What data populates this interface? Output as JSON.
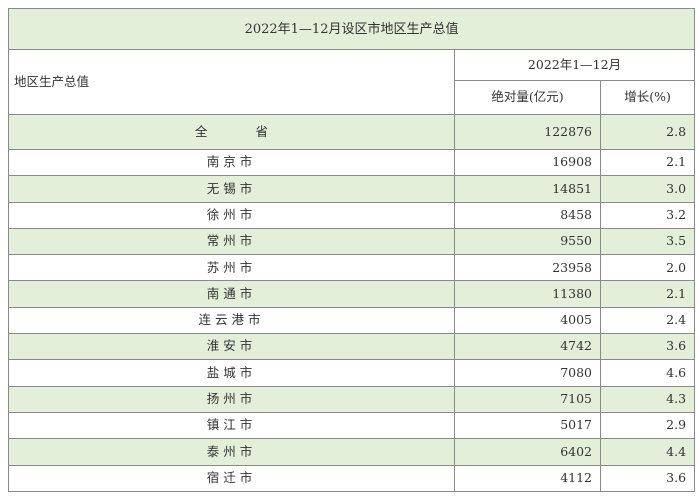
{
  "table": {
    "title": "2022年1—12月设区市地区生产总值",
    "header": {
      "row_label": "地区生产总值",
      "period": "2022年1—12月",
      "col_absolute": "绝对量(亿元)",
      "col_growth": "增长(%)"
    },
    "total": {
      "label": "全省",
      "value": "122876",
      "growth": "2.8"
    },
    "rows": [
      {
        "name": "南京市",
        "value": "16908",
        "growth": "2.1"
      },
      {
        "name": "无锡市",
        "value": "14851",
        "growth": "3.0"
      },
      {
        "name": "徐州市",
        "value": "8458",
        "growth": "3.2"
      },
      {
        "name": "常州市",
        "value": "9550",
        "growth": "3.5"
      },
      {
        "name": "苏州市",
        "value": "23958",
        "growth": "2.0"
      },
      {
        "name": "南通市",
        "value": "11380",
        "growth": "2.1"
      },
      {
        "name": "连云港市",
        "value": "4005",
        "growth": "2.4"
      },
      {
        "name": "淮安市",
        "value": "4742",
        "growth": "3.6"
      },
      {
        "name": "盐城市",
        "value": "7080",
        "growth": "4.6"
      },
      {
        "name": "扬州市",
        "value": "7105",
        "growth": "4.3"
      },
      {
        "name": "镇江市",
        "value": "5017",
        "growth": "2.9"
      },
      {
        "name": "泰州市",
        "value": "6402",
        "growth": "4.4"
      },
      {
        "name": "宿迁市",
        "value": "4112",
        "growth": "3.6"
      }
    ]
  },
  "colors": {
    "stripe_green": "#e3efd9",
    "border": "#8a8a8a",
    "text": "#333333"
  }
}
